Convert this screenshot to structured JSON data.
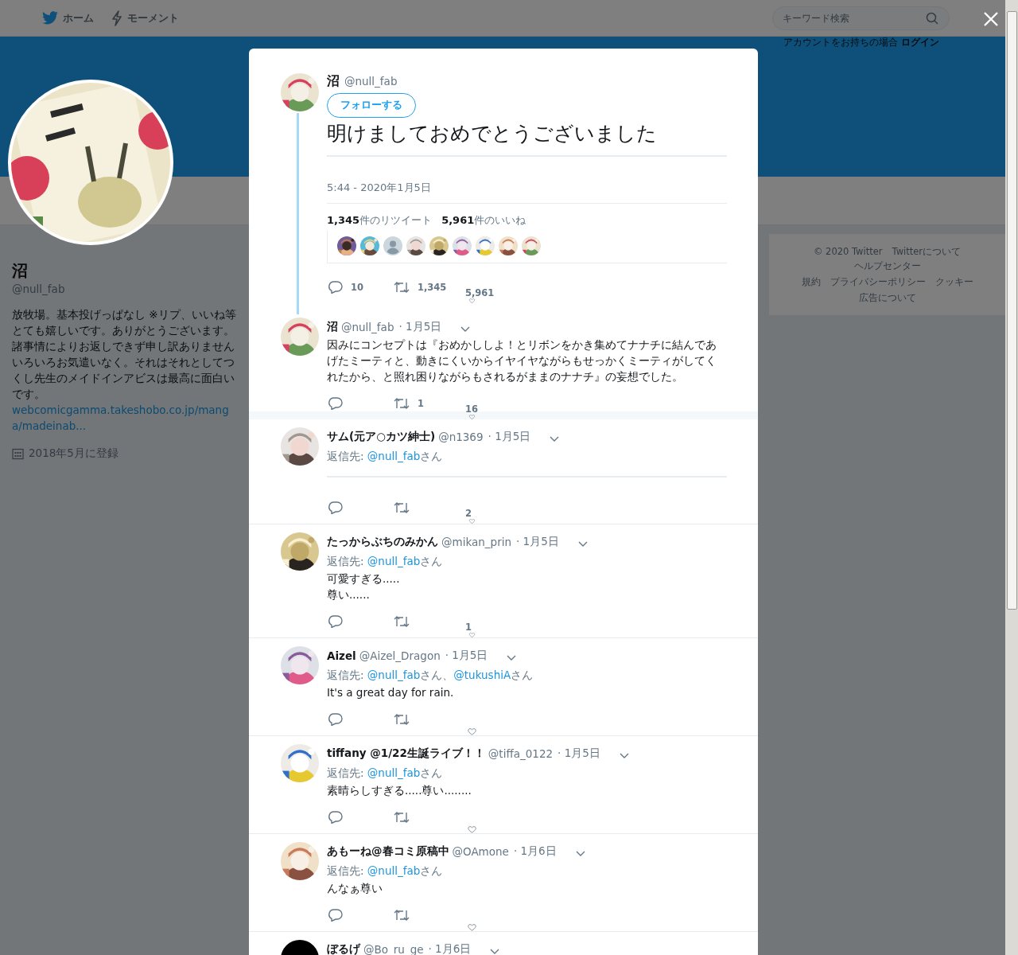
{
  "top_nav": {
    "items": [
      {
        "label": "ホーム",
        "kind": "home"
      },
      {
        "label": "モーメント",
        "kind": "moments"
      }
    ],
    "search": {
      "placeholder": "キーワード検索"
    },
    "login_prompt": "アカウントをお持ちの場合",
    "login_link": "ログイン"
  },
  "profile": {
    "name": "沼",
    "handle": "@null_fab",
    "bio": "放牧場。基本投げっぱなし ※リプ、いいね等とても嬉しいです。ありがとうございます。諸事情によりお返しできず申し訳ありませんいろいろお気遣いなく。それはそれとしてつくし先生のメイドインアビスは最高に面白いです。",
    "bio_link": "webcomicgamma.takeshobo.co.jp/manga/madeinab...",
    "joined": "2018年5月に登録"
  },
  "footer_links": [
    "© 2020 Twitter",
    "Twitterについて",
    "ヘルプセンター",
    "規約",
    "プライバシーポリシー",
    "クッキー",
    "広告について"
  ],
  "modal": {
    "tweet": {
      "name": "沼",
      "handle": "@null_fab",
      "follow_button": "フォローする",
      "text": "明けましておめでとうございました",
      "timestamp": "5:44 - 2020年1月5日",
      "retweet_count": "1,345",
      "retweet_label": "件のリツイート",
      "like_count": "5,961",
      "like_label": "件のいいね",
      "likers": [
        {
          "kind": "picture"
        },
        {
          "kind": "picture"
        },
        {
          "kind": "default"
        },
        {
          "kind": "picture"
        },
        {
          "kind": "picture"
        },
        {
          "kind": "picture"
        },
        {
          "kind": "picture"
        },
        {
          "kind": "picture"
        },
        {
          "kind": "picture"
        }
      ],
      "actions": {
        "replies": "10",
        "retweets": "1,345",
        "likes": "5,961"
      }
    },
    "replies": [
      {
        "kind": "thread",
        "avatar": {
          "kind": "picture"
        },
        "name": "沼",
        "handle": "@null_fab",
        "date": "· 1月5日",
        "text": "因みにコンセプトは『おめかししよ！とリボンをかき集めてナナチに結んであげたミーティと、動きにくいからイヤイヤながらもせっかくミーティがしてくれたから、と照れ困りながらもされるがままのナナチ』の妄想でした。",
        "actions": {
          "retweets": "1",
          "likes": "16"
        }
      },
      {
        "kind": "card",
        "avatar": {
          "kind": "picture"
        },
        "name": "サム(元ア○カツ紳士)",
        "handle": "@n1369",
        "date": "· 1月5日",
        "reply_label": "返信先: ",
        "mentions": [
          {
            "handle": "@null_fab",
            "suffix": "さん"
          }
        ],
        "actions": {
          "likes": "2"
        }
      },
      {
        "kind": "text",
        "avatar": {
          "kind": "picture"
        },
        "name": "たっからぶちのみかん",
        "handle": "@mikan_prin",
        "date": "· 1月5日",
        "reply_label": "返信先: ",
        "mentions": [
          {
            "handle": "@null_fab",
            "suffix": "さん"
          }
        ],
        "text": "可愛すぎる.....\n尊い......",
        "actions": {
          "likes": "1"
        }
      },
      {
        "kind": "text",
        "avatar": {
          "kind": "picture"
        },
        "name": "Aizel",
        "handle": "@Aizel_Dragon",
        "date": "· 1月5日",
        "reply_label": "返信先: ",
        "mentions": [
          {
            "handle": "@null_fab",
            "suffix": "さん、"
          },
          {
            "handle": "@tukushiA",
            "suffix": "さん"
          }
        ],
        "text": "It's a great day for rain."
      },
      {
        "kind": "text",
        "avatar": {
          "kind": "picture"
        },
        "name": "tiffany @1/22生誕ライブ！！",
        "handle": "@tiffa_0122",
        "date": "· 1月5日",
        "reply_label": "返信先: ",
        "mentions": [
          {
            "handle": "@null_fab",
            "suffix": "さん"
          }
        ],
        "text": "素晴らしすぎる.....尊い........"
      },
      {
        "kind": "text",
        "avatar": {
          "kind": "picture"
        },
        "name": "あもーね@春コミ原稿中",
        "handle": "@OAmone",
        "date": "· 1月6日",
        "reply_label": "返信先: ",
        "mentions": [
          {
            "handle": "@null_fab",
            "suffix": "さん"
          }
        ],
        "text": "んなぁ尊い"
      },
      {
        "kind": "header",
        "avatar": {
          "kind": "plain"
        },
        "name": "ぼるげ",
        "handle": "@Bo_ru_ge",
        "date": "· 1月6日"
      }
    ]
  }
}
